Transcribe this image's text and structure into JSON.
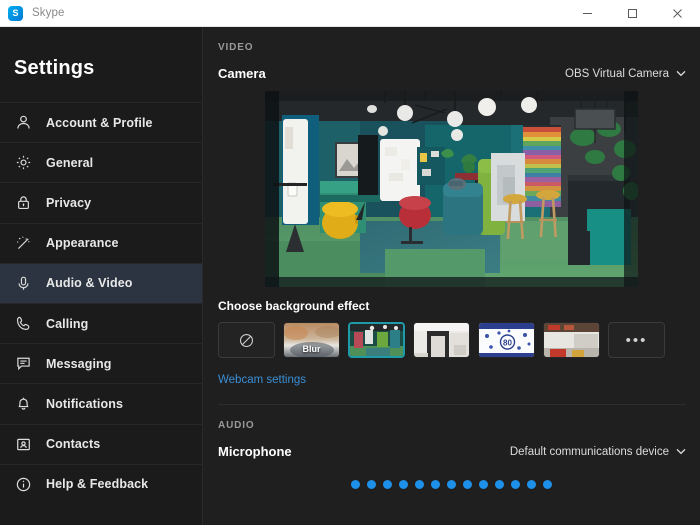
{
  "window": {
    "app_title": "Skype",
    "logo_letter": "S",
    "controls": {
      "minimize": "minimize-button",
      "maximize": "maximize-button",
      "close": "close-button"
    }
  },
  "sidebar": {
    "title": "Settings",
    "items": [
      {
        "label": "Account & Profile",
        "icon": "person-icon",
        "selected": false
      },
      {
        "label": "General",
        "icon": "gear-icon",
        "selected": false
      },
      {
        "label": "Privacy",
        "icon": "lock-icon",
        "selected": false
      },
      {
        "label": "Appearance",
        "icon": "wand-icon",
        "selected": false
      },
      {
        "label": "Audio & Video",
        "icon": "microphone-icon",
        "selected": true
      },
      {
        "label": "Calling",
        "icon": "phone-icon",
        "selected": false
      },
      {
        "label": "Messaging",
        "icon": "chat-icon",
        "selected": false
      },
      {
        "label": "Notifications",
        "icon": "bell-icon",
        "selected": false
      },
      {
        "label": "Contacts",
        "icon": "contact-card-icon",
        "selected": false
      },
      {
        "label": "Help & Feedback",
        "icon": "info-icon",
        "selected": false
      }
    ]
  },
  "main": {
    "video_section": {
      "header": "VIDEO",
      "camera_label": "Camera",
      "camera_value": "OBS Virtual Camera",
      "chevron_icon": "chevron-down-icon",
      "preview_alt": "camera-preview-office-interior"
    },
    "background_effect": {
      "title": "Choose background effect",
      "options": [
        {
          "label": "",
          "kind": "none",
          "icon": "no-effect-icon",
          "selected": false
        },
        {
          "label": "Blur",
          "kind": "blur",
          "icon": "",
          "selected": false
        },
        {
          "label": "",
          "kind": "image-green-office",
          "icon": "",
          "selected": true
        },
        {
          "label": "",
          "kind": "image-white-room",
          "icon": "",
          "selected": false
        },
        {
          "label": "",
          "kind": "image-blue-pattern",
          "icon": "",
          "selected": false
        },
        {
          "label": "",
          "kind": "image-office-hall",
          "icon": "",
          "selected": false
        }
      ],
      "more_label": "•••",
      "more_icon": "ellipsis-icon"
    },
    "webcam_settings_link": "Webcam settings",
    "audio_section": {
      "header": "AUDIO",
      "microphone_label": "Microphone",
      "microphone_value": "Default communications device",
      "chevron_icon": "chevron-down-icon",
      "level_dot_count": 13,
      "level_dot_color": "#1e90e8"
    }
  },
  "colors": {
    "titlebar_bg": "#ffffff",
    "sidebar_bg": "#1b1b1b",
    "main_bg": "#1f1f1f",
    "selected_nav_bg": "#2b3440",
    "link_blue": "#3a8fd6",
    "selection_teal": "#1e9aa8"
  }
}
